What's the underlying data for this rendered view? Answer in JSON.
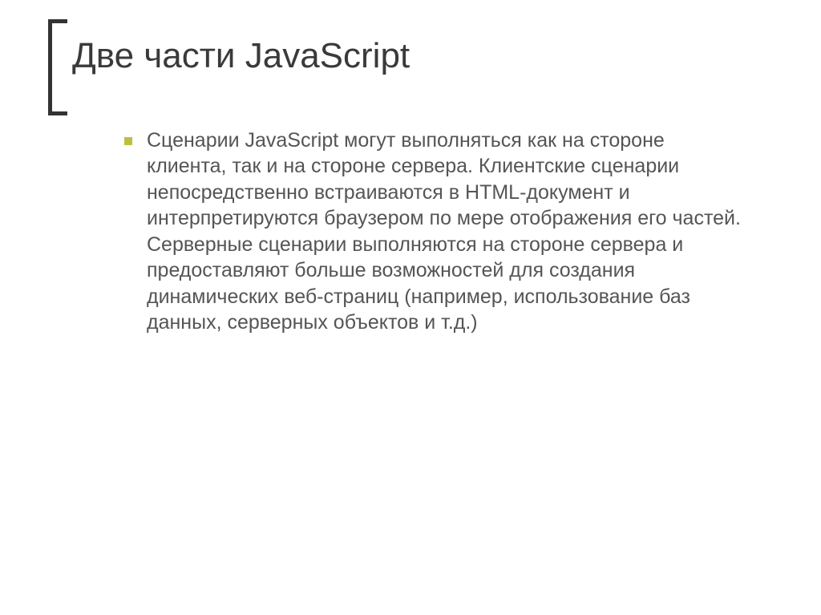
{
  "slide": {
    "title": "Две части JavaScript",
    "bullets": [
      {
        "text": "Сценарии JavaScript могут выполняться как на стороне клиента, так и на стороне сервера. Клиентские сценарии непосредственно встраиваются в HTML-документ и интерпретируются браузером по мере отображения его частей. Серверные сценарии выполняются на стороне сервера и предоставляют больше возможностей для создания динамических веб-страниц (например, использование баз данных, серверных объектов и т.д.)"
      }
    ]
  }
}
